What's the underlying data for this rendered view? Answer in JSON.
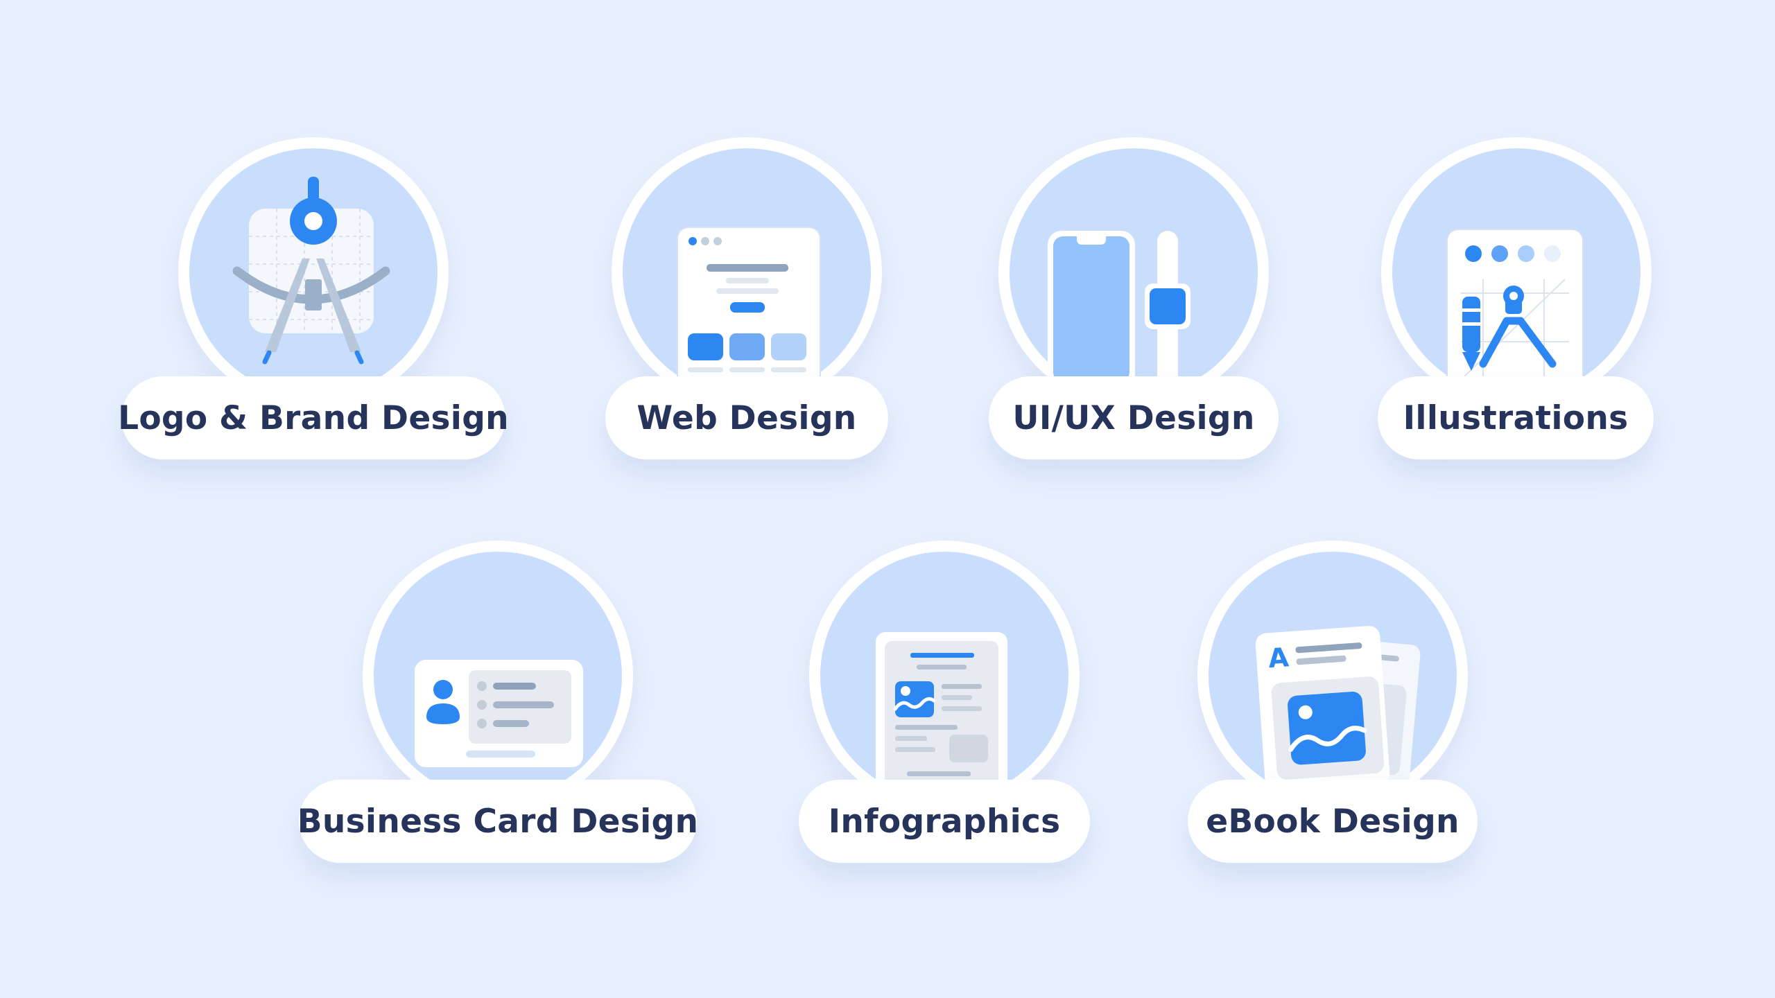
{
  "categories": [
    {
      "label": "Logo & Brand Design",
      "icon": "compass-logo-icon"
    },
    {
      "label": "Web Design",
      "icon": "website-layout-icon"
    },
    {
      "label": "UI/UX Design",
      "icon": "phone-slider-icon"
    },
    {
      "label": "Illustrations",
      "icon": "pen-tool-canvas-icon"
    },
    {
      "label": "Business Card Design",
      "icon": "business-card-icon"
    },
    {
      "label": "Infographics",
      "icon": "infographic-document-icon"
    },
    {
      "label": "eBook Design",
      "icon": "ebook-pages-icon"
    }
  ],
  "colors": {
    "background": "#e8f0fe",
    "circle_fill": "#c9defc",
    "accent": "#2d87f2",
    "label_text": "#26335a"
  }
}
